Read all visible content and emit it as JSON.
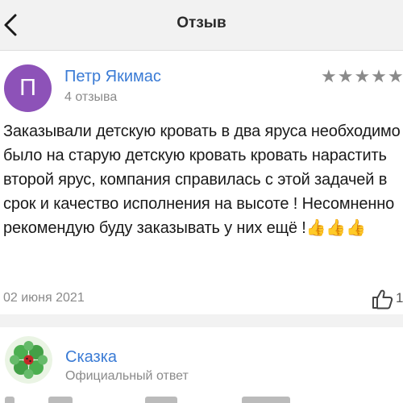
{
  "header": {
    "title": "Отзыв",
    "back_icon": "chevron-left-icon"
  },
  "review": {
    "avatar_letter": "П",
    "avatar_color": "#8d52b8",
    "author": "Петр Якимас",
    "reviews_count": "4 отзыва",
    "rating": 5,
    "rating_max": 5,
    "stars": "★★★★★",
    "text": "Заказывали детскую кровать в два яруса необходимо было на старую детскую кровать кровать нарастить второй ярус, компания справилась с этой задачей в срок и качество исполнения на высоте ! Несомненно рекомендую буду заказывать у них ещё !",
    "emoji": "👍👍👍",
    "date": "02 июня 2021",
    "likes": "1",
    "like_icon": "thumbs-up-icon"
  },
  "response": {
    "company": "Сказка",
    "label": "Официальный ответ",
    "avatar_icon": "clover-logo-icon"
  },
  "colors": {
    "accent": "#3a7bd5",
    "muted": "#8a8a8a",
    "header_bg": "#f2f2f2"
  }
}
